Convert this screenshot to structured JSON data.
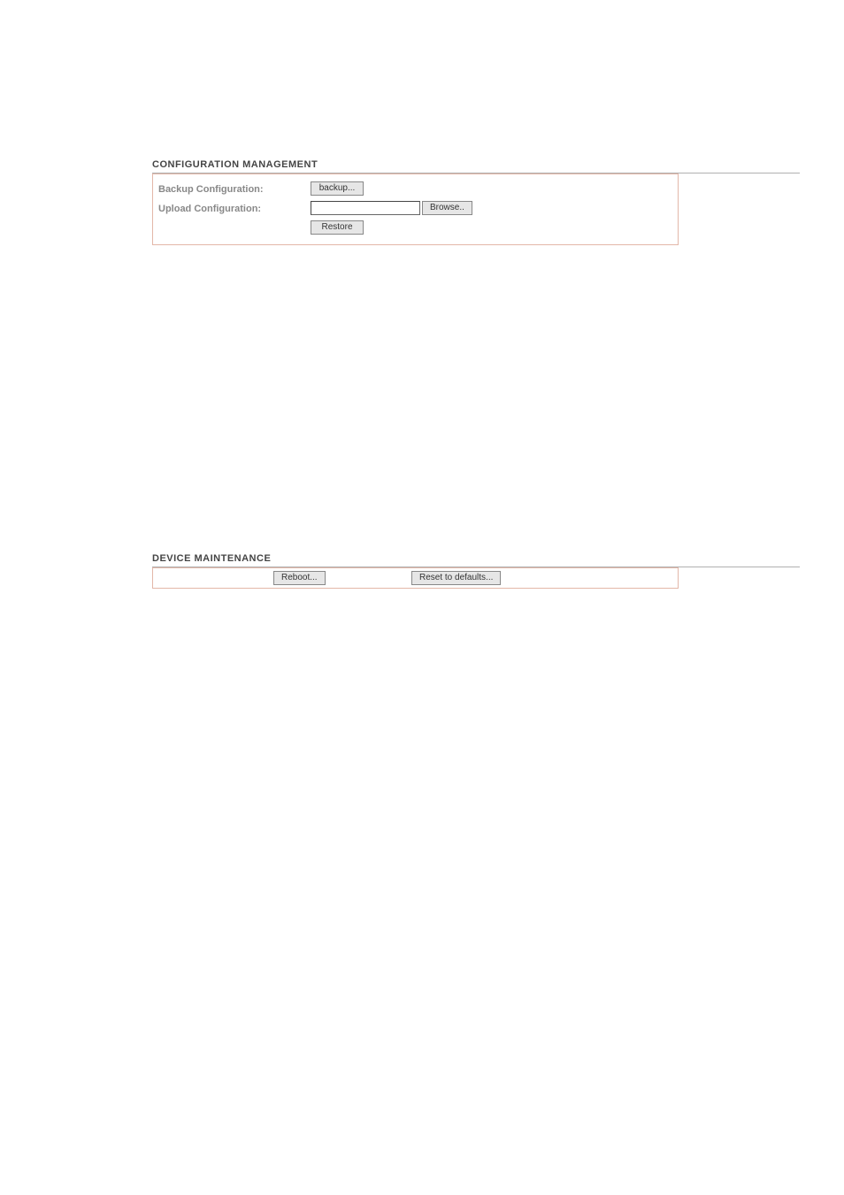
{
  "config": {
    "title": "CONFIGURATION MANAGEMENT",
    "backup_label": "Backup Configuration:",
    "upload_label": "Upload Configuration:",
    "backup_button": "backup...",
    "browse_button": "Browse..",
    "restore_button": "Restore",
    "upload_value": ""
  },
  "maintenance": {
    "title": "DEVICE MAINTENANCE",
    "reboot_button": "Reboot...",
    "reset_button": "Reset to defaults..."
  }
}
